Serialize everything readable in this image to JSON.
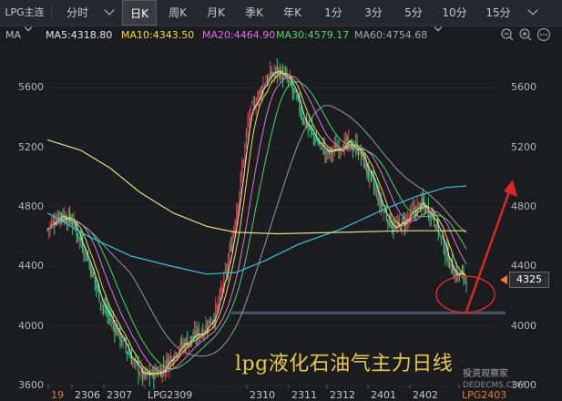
{
  "toolbar": {
    "symbol": "LPG主连",
    "tabs": [
      {
        "label": "分时",
        "chevron": false
      },
      {
        "label": "",
        "chevron": true
      },
      {
        "label": "日K",
        "active": true
      },
      {
        "label": "周K"
      },
      {
        "label": "月K"
      },
      {
        "label": "季K"
      },
      {
        "label": "年K"
      },
      {
        "label": "1分"
      },
      {
        "label": "3分"
      },
      {
        "label": "5分"
      },
      {
        "label": "10分"
      },
      {
        "label": "15分"
      }
    ]
  },
  "ma": {
    "label": "MA",
    "items": [
      {
        "text": "MA5:4318.80",
        "color": "#e6e6e6"
      },
      {
        "text": "MA10:4343.50",
        "color": "#f5d742"
      },
      {
        "text": "MA20:4464.90",
        "color": "#e070e0"
      },
      {
        "text": "MA30:4579.17",
        "color": "#4fd36a"
      },
      {
        "text": "MA60:4754.68",
        "color": "#a8a8a8"
      }
    ],
    "icons": [
      "zoom-out-icon",
      "zoom-in-icon",
      "more-icon"
    ]
  },
  "chart_data": {
    "type": "candlestick",
    "y_ticks": [
      5600,
      5200,
      4800,
      4400,
      4000,
      3600
    ],
    "ylim": [
      3590,
      5870
    ],
    "x_labels": [
      "19",
      "2306",
      "2307",
      "LPG2309",
      "2310",
      "2311",
      "2312",
      "2401",
      "2402",
      "LPG2403"
    ],
    "last_price": "4325",
    "support_level": 4090,
    "ma_colors": {
      "ma5": "#e6e6e6",
      "ma10": "#f5d742",
      "ma20": "#e070e0",
      "ma30": "#4fd36a",
      "ma60": "#9a9a9a",
      "ma120": "#36c4e0",
      "ma250": "#e0e08a"
    },
    "caption": "lpg液化石油气主力日线"
  },
  "watermark": {
    "line1": "投资观察家",
    "line2": "DEDECMS.COM"
  }
}
